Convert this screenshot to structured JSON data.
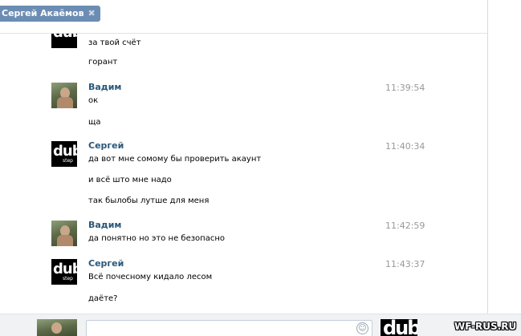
{
  "header": {
    "chat_tag": "Сергей Акаёмов",
    "close_glyph": "✖"
  },
  "messages": [
    {
      "author": "",
      "time": "",
      "lines": [
        "за твой счёт",
        "горант"
      ]
    },
    {
      "author": "Вадим",
      "time": "11:39:54",
      "lines": [
        "ок",
        "ща"
      ]
    },
    {
      "author": "Сергей",
      "time": "11:40:34",
      "lines": [
        "да вот мне сомому бы проверить акаунт",
        "и всё што мне надо",
        "так былобы лутше для меня"
      ]
    },
    {
      "author": "Вадим",
      "time": "11:42:59",
      "lines": [
        "да понятно но это не безопасно"
      ]
    },
    {
      "author": "Сергей",
      "time": "11:43:37",
      "lines": [
        "Всё почесному кидало лесом",
        "даёте?"
      ]
    }
  ],
  "avatars": {
    "dub_logo": "dub",
    "dub_sub": "step"
  },
  "composer": {
    "placeholder": "",
    "smile_icon": "☺"
  },
  "watermark": "WF-RUS.RU",
  "colors": {
    "tag_bg": "#6c8db3",
    "author": "#2b587a",
    "time": "#999999"
  }
}
